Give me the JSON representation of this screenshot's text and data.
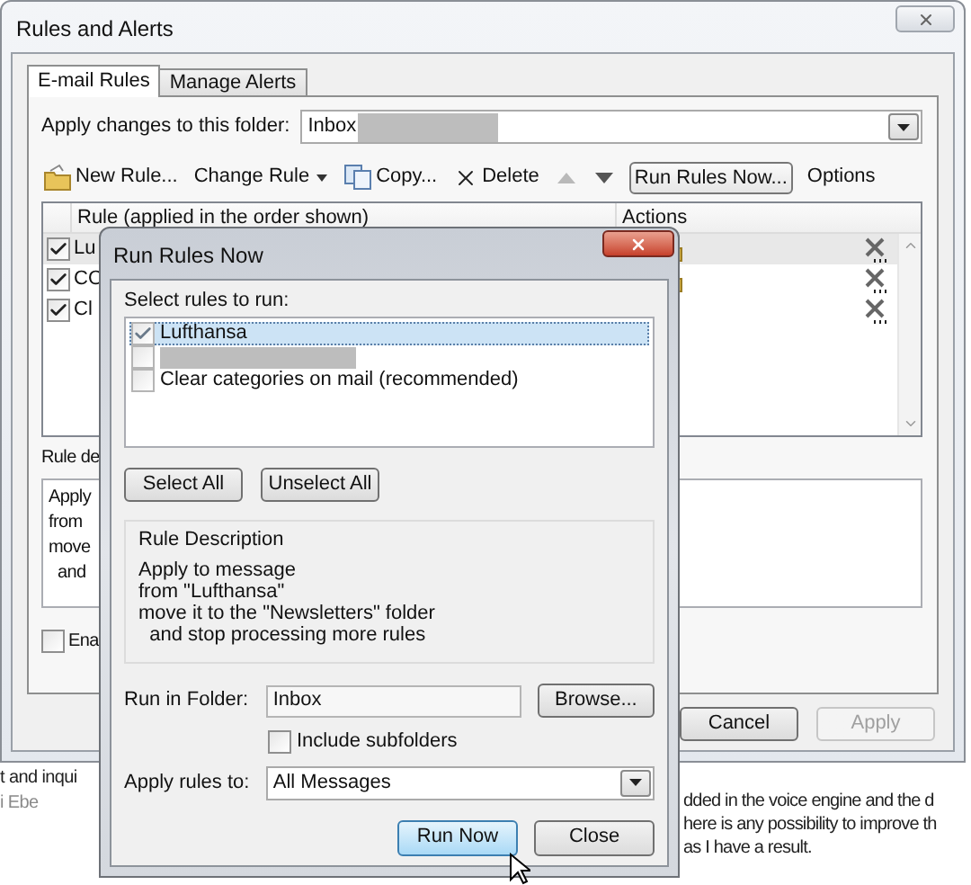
{
  "window": {
    "title": "Rules and Alerts"
  },
  "tabs": [
    {
      "label": "E-mail Rules",
      "selected": true
    },
    {
      "label": "Manage Alerts",
      "selected": false
    }
  ],
  "folder": {
    "label": "Apply changes to this folder:",
    "value": "Inbox",
    "redacted": true
  },
  "toolbar": [
    {
      "kind": "new",
      "label": "New Rule..."
    },
    {
      "kind": "menu",
      "label": "Change Rule"
    },
    {
      "kind": "copy",
      "label": "Copy..."
    },
    {
      "kind": "delete",
      "label": "Delete"
    },
    {
      "kind": "up",
      "disabled": true
    },
    {
      "kind": "down",
      "disabled": false
    },
    {
      "kind": "boxed",
      "label": "Run Rules Now..."
    },
    {
      "kind": "plain",
      "label": "Options"
    }
  ],
  "rules_table": {
    "columns": [
      "Rule (applied in the order shown)",
      "Actions"
    ],
    "rows": [
      {
        "name": "Lu",
        "checked": true,
        "selected": true,
        "move_action": true
      },
      {
        "name": "CO",
        "checked": true,
        "selected": false,
        "move_action": true
      },
      {
        "name": "Cl",
        "checked": true,
        "selected": false,
        "move_action": false
      }
    ]
  },
  "rule_description": {
    "label": "Rule de",
    "lines": [
      "Apply",
      "from",
      "move",
      "  and"
    ]
  },
  "enable": {
    "label": "Ena",
    "checked": false
  },
  "buttons": [
    {
      "label": "Cancel",
      "disabled": false
    },
    {
      "label": "Apply",
      "disabled": true
    }
  ],
  "run_rules_dialog": {
    "title": "Run Rules Now",
    "select_label": "Select rules to run:",
    "rules": [
      {
        "name": "Lufthansa",
        "checked": true,
        "selected": true,
        "redacted": false
      },
      {
        "checked": false,
        "selected": false,
        "redacted": true
      },
      {
        "name": "Clear categories on mail (recommended)",
        "checked": false,
        "selected": false,
        "redacted": false
      }
    ],
    "select_buttons": [
      "Select All",
      "Unselect All"
    ],
    "description_title": "Rule Description",
    "description_lines": [
      "Apply to message",
      "from \"Lufthansa\"",
      "move it to the \"Newsletters\" folder",
      "  and stop processing more rules"
    ],
    "run_in_folder": {
      "label": "Run in Folder:",
      "value": "Inbox",
      "browse": "Browse..."
    },
    "include_subfolders": {
      "label": "Include subfolders",
      "checked": false
    },
    "apply_rules_to": {
      "label": "Apply rules to:",
      "value": "All Messages"
    },
    "actions": [
      {
        "label": "Run Now",
        "default": true
      },
      {
        "label": "Close",
        "default": false
      }
    ]
  },
  "background_text": {
    "left": [
      {
        "text": "t and inqui",
        "muted": false
      },
      {
        "text": "i Ebe",
        "muted": true
      }
    ],
    "right": [
      "dded in the voice engine and the d",
      "here is any possibility to improve th",
      "as I have a result."
    ]
  }
}
